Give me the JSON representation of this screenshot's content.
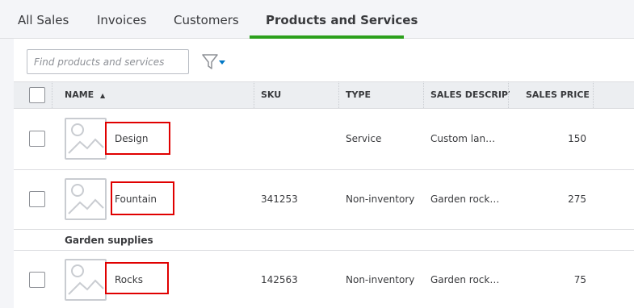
{
  "tabs": [
    {
      "label": "All Sales"
    },
    {
      "label": "Invoices"
    },
    {
      "label": "Customers"
    },
    {
      "label": "Products and Services",
      "active": true
    }
  ],
  "search": {
    "placeholder": "Find products and services"
  },
  "table": {
    "headers": {
      "name": "NAME",
      "sku": "SKU",
      "type": "TYPE",
      "sales_desc": "SALES DESCRIPT",
      "sales_price": "SALES PRICE"
    },
    "sort_indicator": "▲",
    "rows": [
      {
        "name": "Design",
        "sku": "",
        "type": "Service",
        "sales_desc": "Custom lan…",
        "sales_price": "150"
      },
      {
        "name": "Fountain",
        "sku": "341253",
        "type": "Non-inventory",
        "sales_desc": "Garden rock…",
        "sales_price": "275"
      },
      {
        "name": "Rocks",
        "sku": "142563",
        "type": "Non-inventory",
        "sales_desc": "Garden rock…",
        "sales_price": "75"
      }
    ],
    "group_label": "Garden supplies"
  },
  "icons": {
    "filter": "filter-funnel-icon",
    "thumbnail": "image-placeholder-icon"
  },
  "colors": {
    "accent": "#2ca01c",
    "highlight_box": "#e00000",
    "page_bg": "#f4f5f8",
    "header_bg": "#eceef1"
  }
}
